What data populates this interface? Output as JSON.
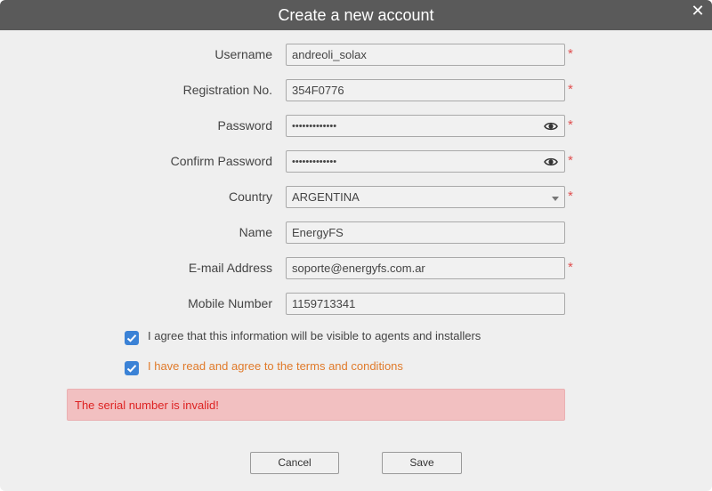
{
  "dialog": {
    "title": "Create a new account",
    "close_symbol": "✕"
  },
  "form": {
    "required_marker": "*",
    "username": {
      "label": "Username",
      "value": "andreoli_solax",
      "required": true
    },
    "registration": {
      "label": "Registration No.",
      "value": "354F0776",
      "required": true
    },
    "password": {
      "label": "Password",
      "value": "•••••••••••••",
      "required": true,
      "icon": "eye-icon"
    },
    "confirm_password": {
      "label": "Confirm Password",
      "value": "•••••••••••••",
      "required": true,
      "icon": "eye-icon"
    },
    "country": {
      "label": "Country",
      "value": "ARGENTINA",
      "required": true
    },
    "name": {
      "label": "Name",
      "value": "EnergyFS",
      "required": false
    },
    "email": {
      "label": "E-mail Address",
      "value": "soporte@energyfs.com.ar",
      "required": true
    },
    "mobile": {
      "label": "Mobile Number",
      "value": "1159713341",
      "required": false
    }
  },
  "agreements": {
    "visibility": {
      "label": "I agree that this information will be visible to agents and installers",
      "checked": true
    },
    "terms": {
      "label": "I have read and agree to the terms and conditions",
      "checked": true
    }
  },
  "error": {
    "message": "The serial number is invalid!"
  },
  "buttons": {
    "cancel": "Cancel",
    "save": "Save"
  },
  "colors": {
    "titlebar": "#5a5a5a",
    "background": "#efefef",
    "required": "#e05050",
    "checkbox": "#3b82d6",
    "terms_link": "#e07a2a",
    "error_bg": "#f2c0c1",
    "error_text": "#d22222"
  }
}
